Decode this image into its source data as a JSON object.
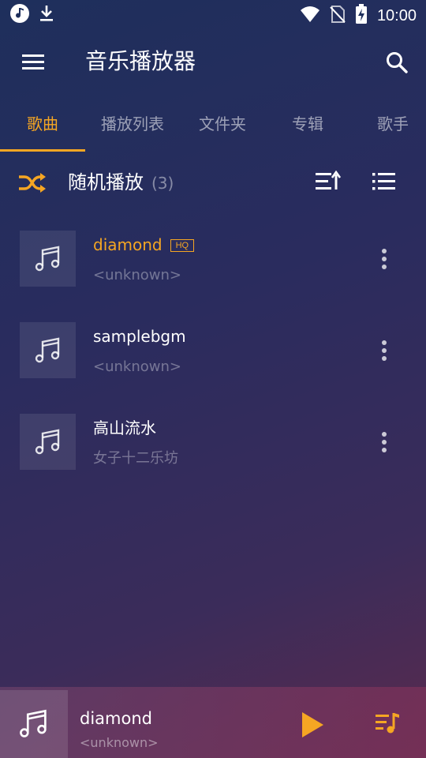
{
  "status_bar": {
    "time": "10:00",
    "icons": [
      "music-note-icon",
      "download-icon",
      "wifi-icon",
      "no-sim-icon",
      "battery-charging-icon"
    ]
  },
  "app_bar": {
    "title": "音乐播放器",
    "icons": [
      "menu-icon",
      "search-icon"
    ]
  },
  "tabs": [
    {
      "label": "歌曲",
      "active": true
    },
    {
      "label": "播放列表",
      "active": false
    },
    {
      "label": "文件夹",
      "active": false
    },
    {
      "label": "专辑",
      "active": false
    },
    {
      "label": "歌手",
      "active": false
    }
  ],
  "shuffle": {
    "label": "随机播放",
    "count": "(3)",
    "icons": [
      "shuffle-icon",
      "sort-icon",
      "list-icon"
    ]
  },
  "songs": [
    {
      "title": "diamond",
      "artist": "<unknown>",
      "badge": "HQ",
      "playing": true
    },
    {
      "title": "samplebgm",
      "artist": "<unknown>",
      "badge": "",
      "playing": false
    },
    {
      "title": "高山流水",
      "artist": "女子十二乐坊",
      "badge": "",
      "playing": false
    }
  ],
  "now_playing": {
    "title": "diamond",
    "artist": "<unknown>",
    "icons": [
      "play-icon",
      "queue-icon"
    ]
  },
  "colors": {
    "accent": "#f5a623",
    "text_primary": "#ffffff",
    "text_secondary": "rgba(255,255,255,0.35)"
  }
}
